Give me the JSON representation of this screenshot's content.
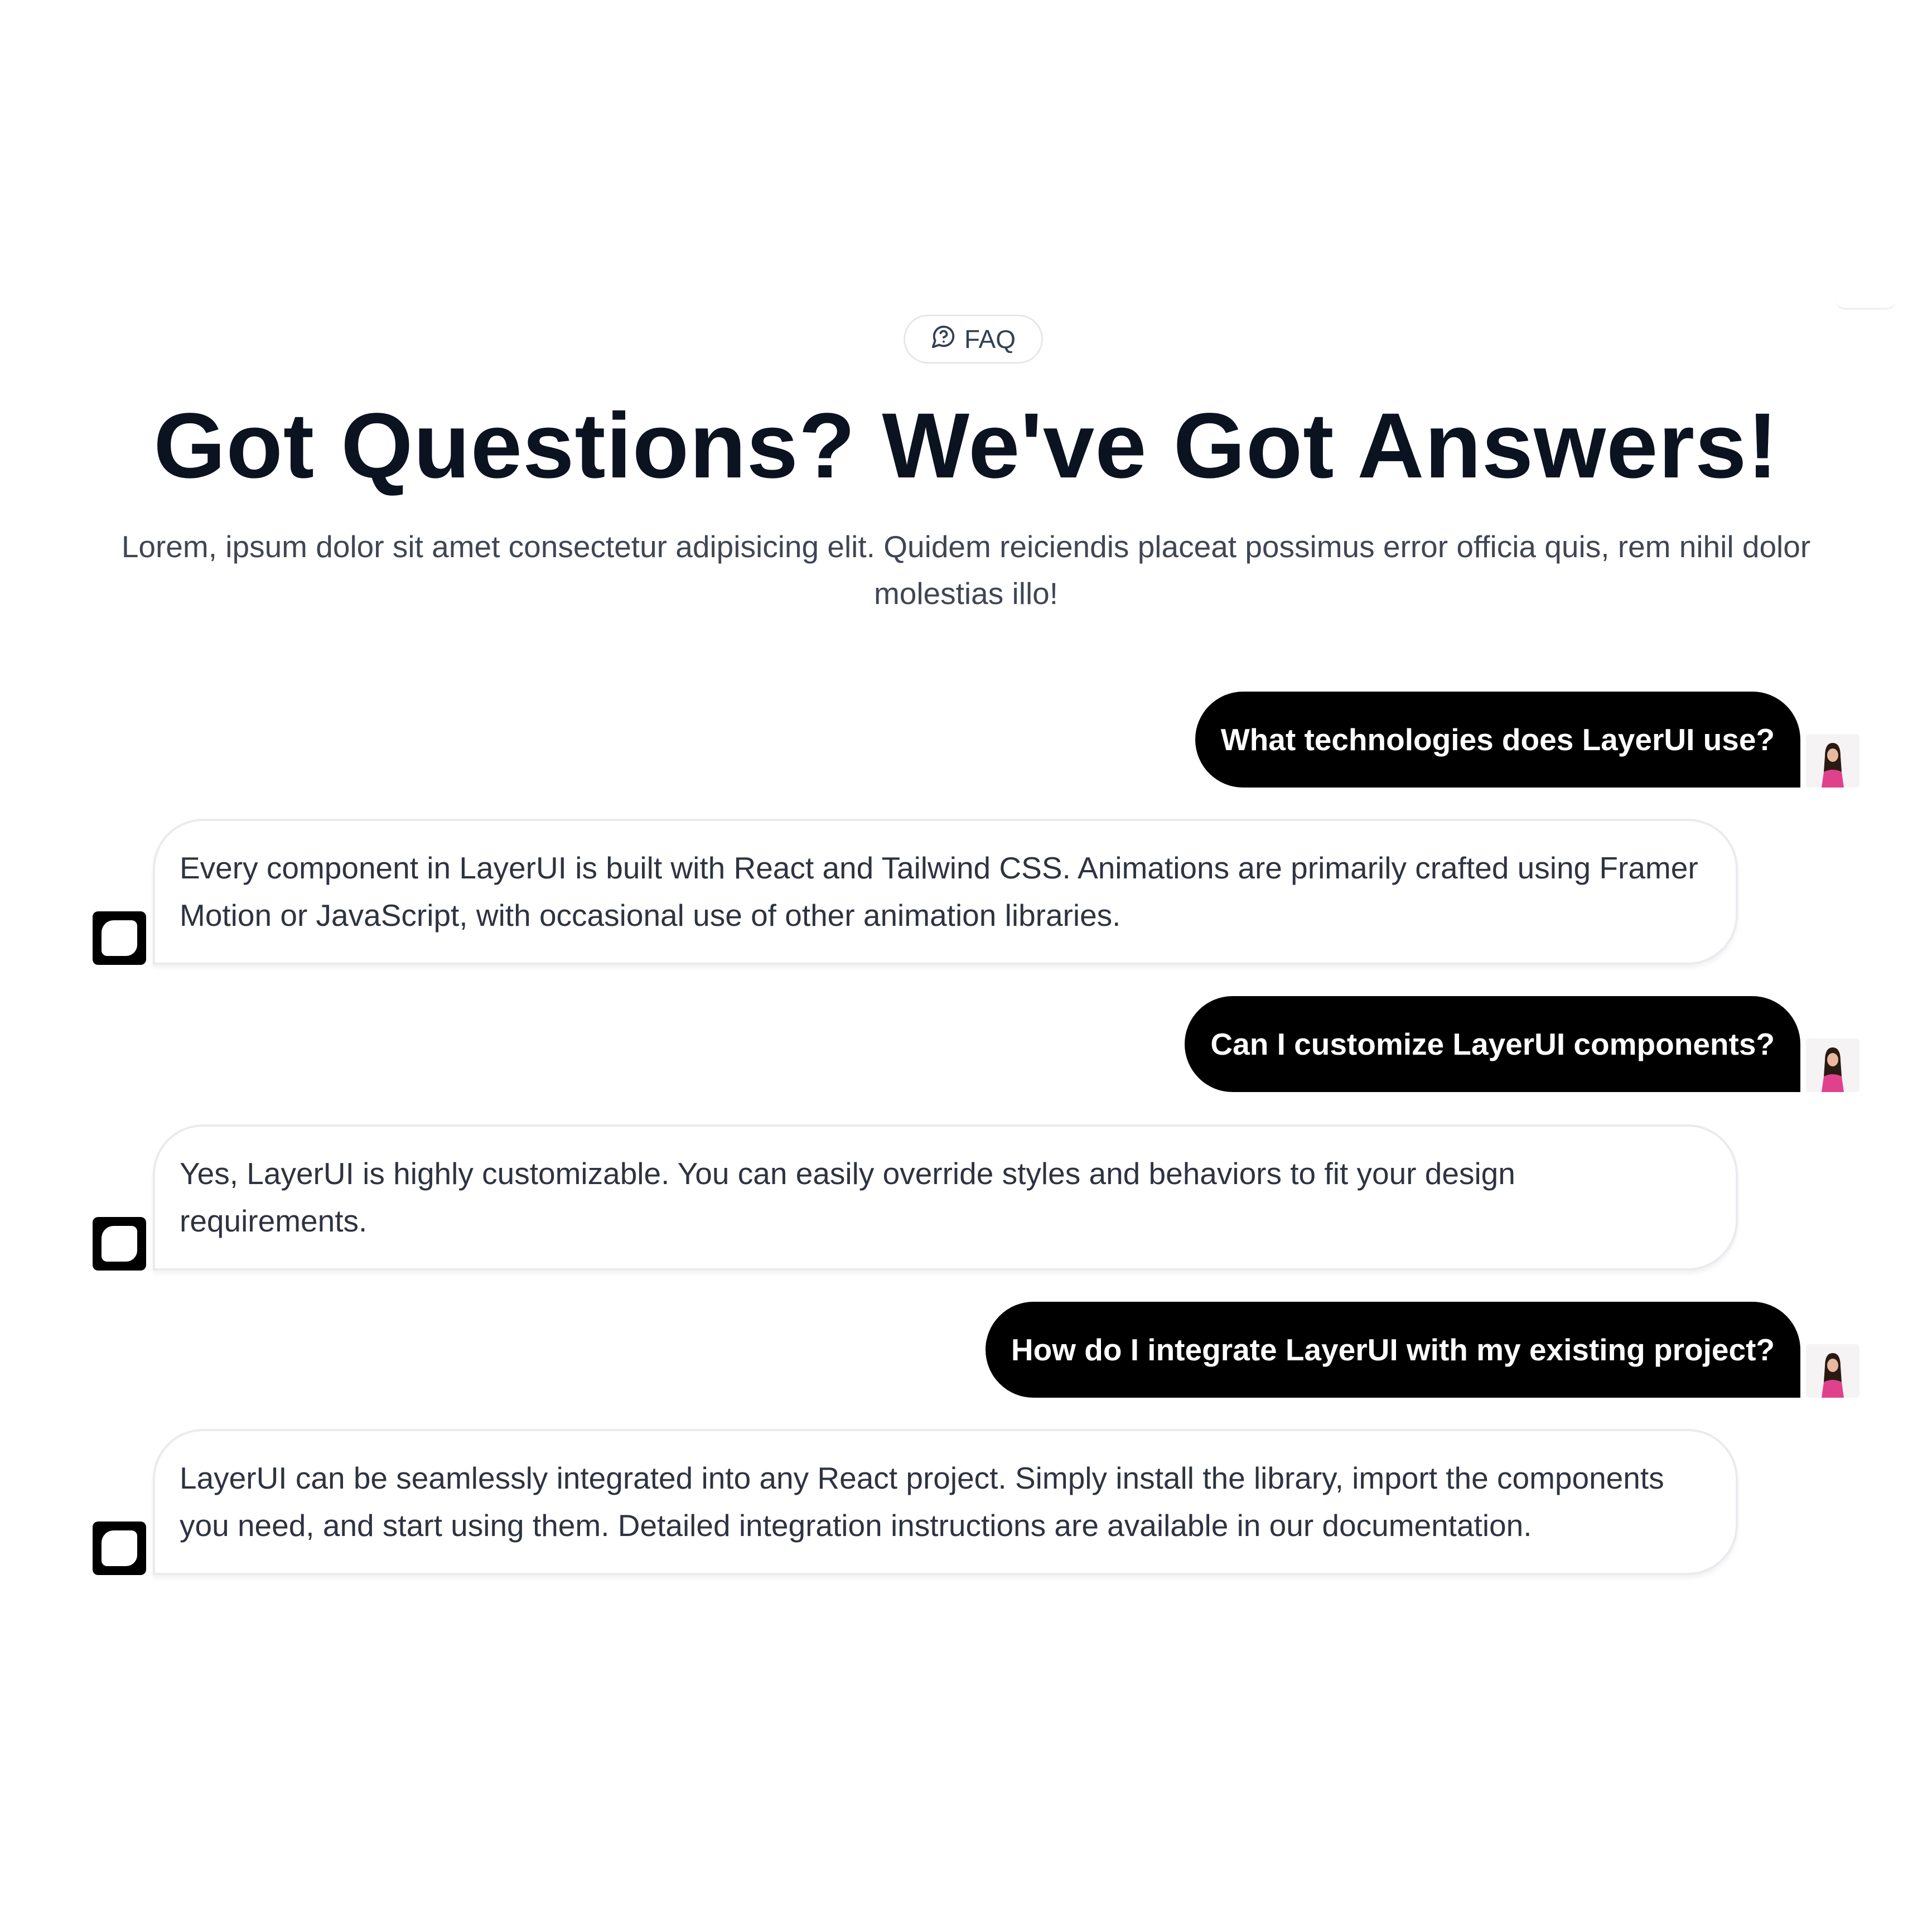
{
  "badge": {
    "icon": "message-question-icon",
    "label": "FAQ"
  },
  "title": "Got Questions? We've Got Answers!",
  "subtitle": "Lorem, ipsum dolor sit amet consectetur adipisicing elit. Quidem reiciendis placeat possimus error officia quis, rem nihil dolor molestias illo!",
  "faq": [
    {
      "question": "What technologies does LayerUI use?",
      "answer": "Every component in LayerUI is built with React and Tailwind CSS. Animations are primarily crafted using Framer Motion or JavaScript, with occasional use of other animation libraries."
    },
    {
      "question": "Can I customize LayerUI components?",
      "answer": "Yes, LayerUI is highly customizable. You can easily override styles and behaviors to fit your design requirements."
    },
    {
      "question": "How do I integrate LayerUI with my existing project?",
      "answer": "LayerUI can be seamlessly integrated into any React project. Simply install the library, import the components you need, and start using them. Detailed integration instructions are available in our documentation."
    }
  ],
  "colors": {
    "question_bg": "#000000",
    "answer_border": "#e9ebef",
    "title": "#0b1220"
  }
}
